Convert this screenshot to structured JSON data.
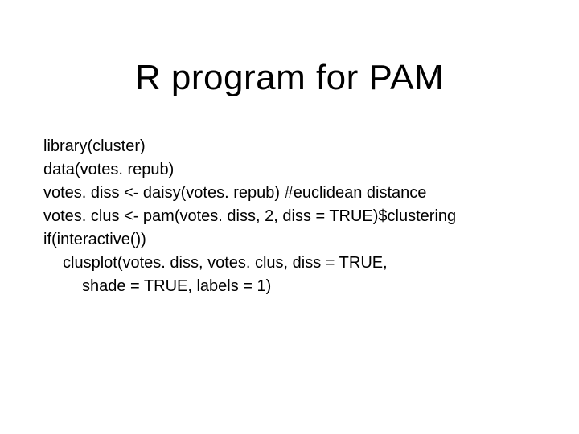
{
  "title": "R program for PAM",
  "code": {
    "l1": "library(cluster)",
    "l2": "data(votes. repub)",
    "l3": "votes. diss <- daisy(votes. repub) #euclidean distance",
    "l4": "votes. clus <- pam(votes. diss, 2, diss = TRUE)$clustering",
    "l5": "if(interactive())",
    "l6": "clusplot(votes. diss, votes. clus, diss = TRUE,",
    "l7": "shade = TRUE, labels = 1)"
  }
}
